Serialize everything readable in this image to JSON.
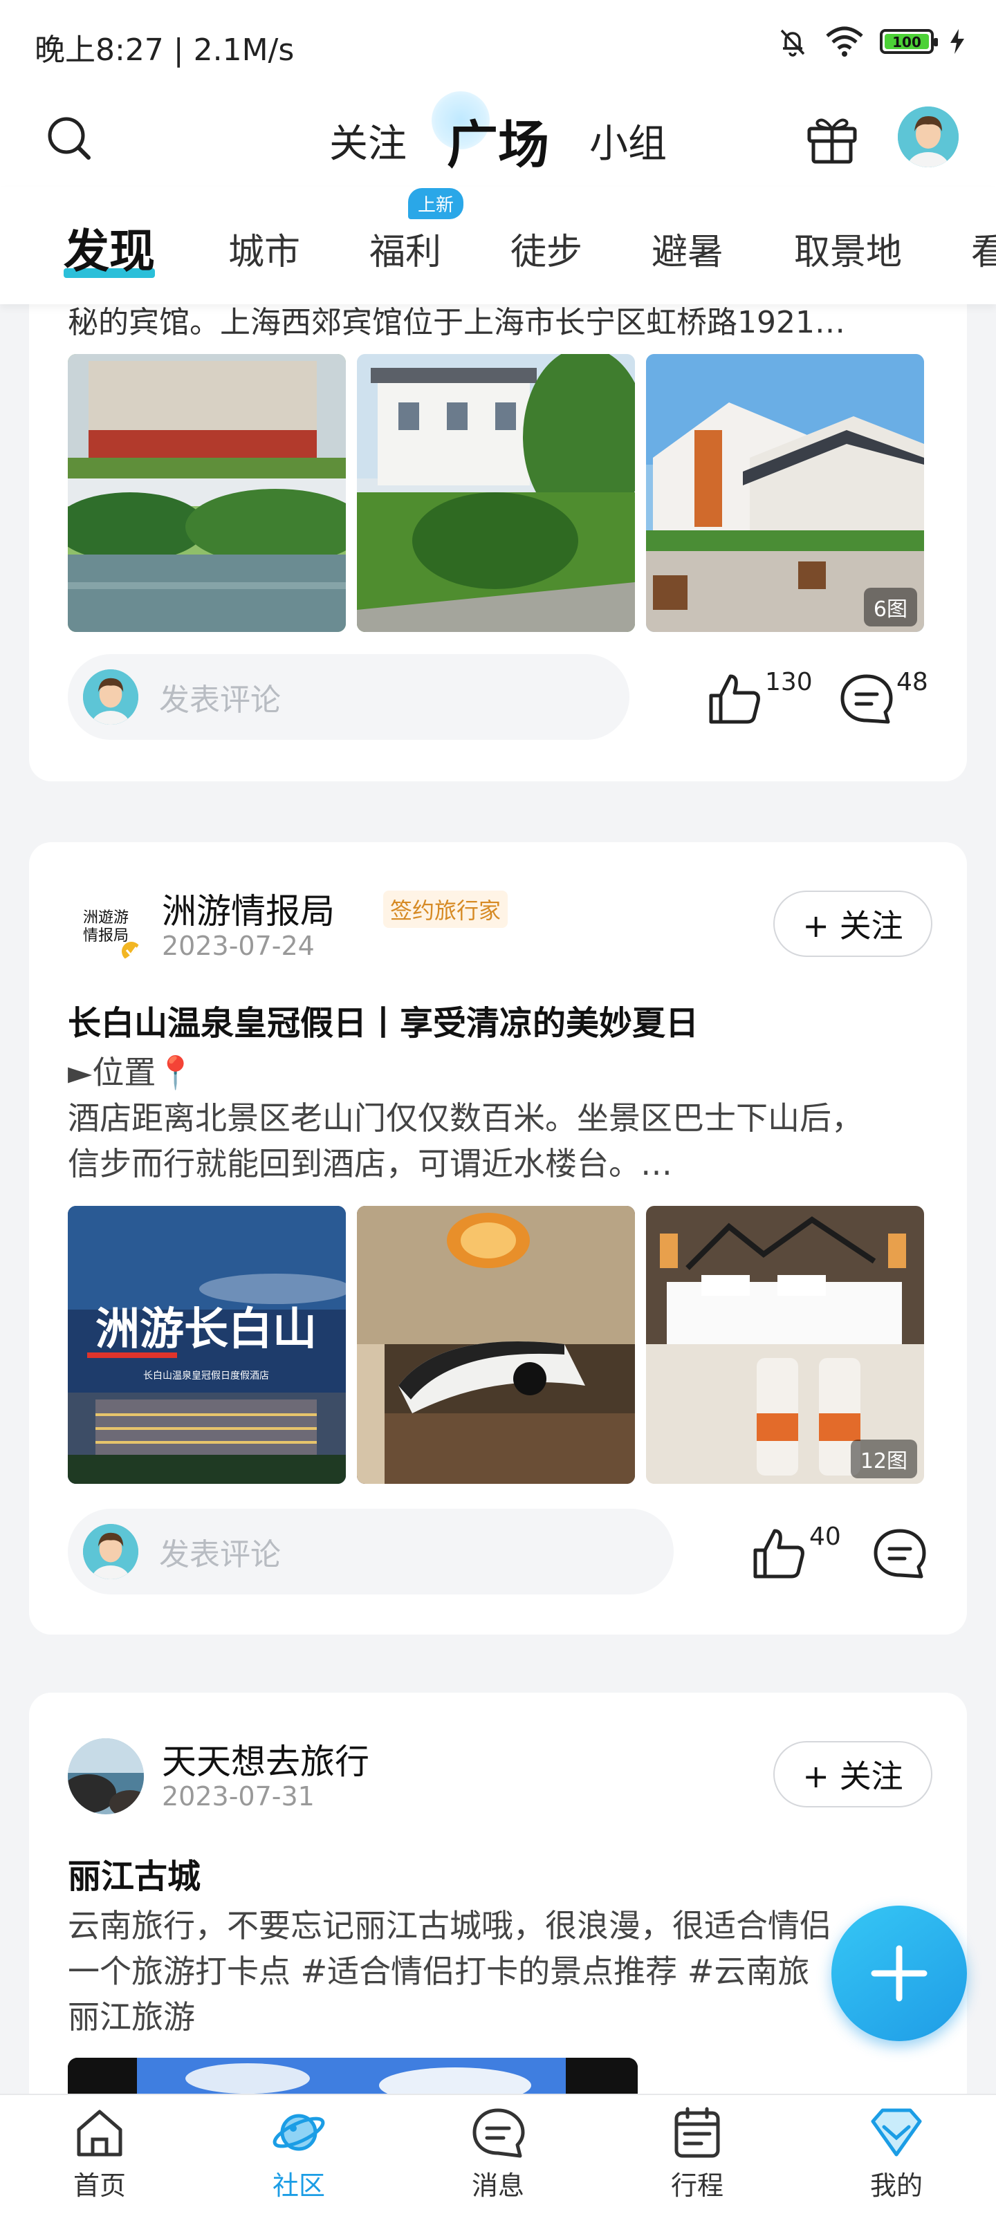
{
  "status_bar": {
    "time_speed": "晚上8:27 | 2.1M/s",
    "battery": "100"
  },
  "top_nav": {
    "tabs": [
      {
        "label": "关注"
      },
      {
        "label": "广场"
      },
      {
        "label": "小组"
      }
    ]
  },
  "category_tabs": {
    "items": [
      "发现",
      "城市",
      "福利",
      "徒步",
      "避暑",
      "取景地",
      "看"
    ],
    "new_badge": "上新"
  },
  "post1": {
    "excerpt_tail": "秘的宾馆。上海西郊宾馆位于上海市长宁区虹桥路1921…",
    "image_count": "6图",
    "comment_placeholder": "发表评论",
    "likes": "130",
    "comments": "48"
  },
  "post2": {
    "author": "洲游情报局",
    "avatar_text": "洲遊游\n情报局",
    "tag": "签约旅行家",
    "date": "2023-07-24",
    "follow_label": "+ 关注",
    "title": "长白山温泉皇冠假日丨享受清凉的美妙夏日",
    "body_line1": "►位置📍",
    "body_line2": "酒店距离北景区老山门仅仅数百米。坐景区巴士下山后，",
    "body_line3": "信步而行就能回到酒店，可谓近水楼台。…",
    "image1_title": "洲游长白山",
    "image1_subtitle": "长白山温泉皇冠假日度假酒店",
    "image_count": "12图",
    "comment_placeholder": "发表评论",
    "likes": "40"
  },
  "post3": {
    "author": "天天想去旅行",
    "date": "2023-07-31",
    "follow_label": "+ 关注",
    "title": "丽江古城",
    "body_line1": "云南旅行，不要忘记丽江古城哦，很浪漫，很适合情侣",
    "body_line2": "一个旅游打卡点 #适合情侣打卡的景点推荐 #云南旅",
    "body_line3": "丽江旅游"
  },
  "bottom_nav": {
    "items": [
      {
        "label": "首页"
      },
      {
        "label": "社区"
      },
      {
        "label": "消息"
      },
      {
        "label": "行程"
      },
      {
        "label": "我的"
      }
    ]
  },
  "colors": {
    "accent": "#1b9de5",
    "tag": "#d68a24",
    "underline": "#2bbfd9"
  }
}
